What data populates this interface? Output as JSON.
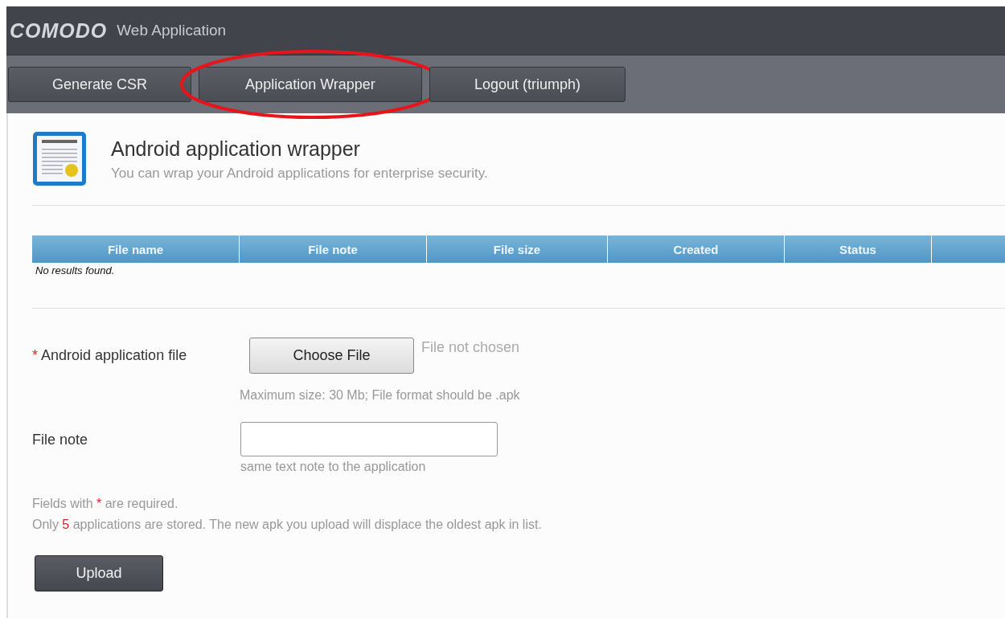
{
  "header": {
    "logo": "COMODO",
    "title": "Web Application"
  },
  "nav": [
    {
      "label": "Generate CSR",
      "highlighted": false
    },
    {
      "label": "Application Wrapper",
      "highlighted": true
    },
    {
      "label": "Logout (triumph)",
      "highlighted": false
    }
  ],
  "page": {
    "title": "Android application wrapper",
    "subtitle": "You can wrap your Android applications for enterprise security."
  },
  "table": {
    "columns": [
      "File name",
      "File note",
      "File size",
      "Created",
      "Status"
    ],
    "empty_message": "No results found."
  },
  "form": {
    "file_field": {
      "label": "Android application file",
      "required": true,
      "button": "Choose File",
      "status": "File not chosen",
      "hint": "Maximum size: 30 Mb; File format should be .apk"
    },
    "note_field": {
      "label": "File note",
      "required": false,
      "hint": "same text note to the application"
    }
  },
  "notes": [
    {
      "before": "Fields with ",
      "mark": "*",
      "after": " are required."
    },
    {
      "before": "Only ",
      "mark": "5",
      "after": " applications are stored. The new apk you upload will displace the oldest apk in list."
    }
  ],
  "submit": "Upload"
}
